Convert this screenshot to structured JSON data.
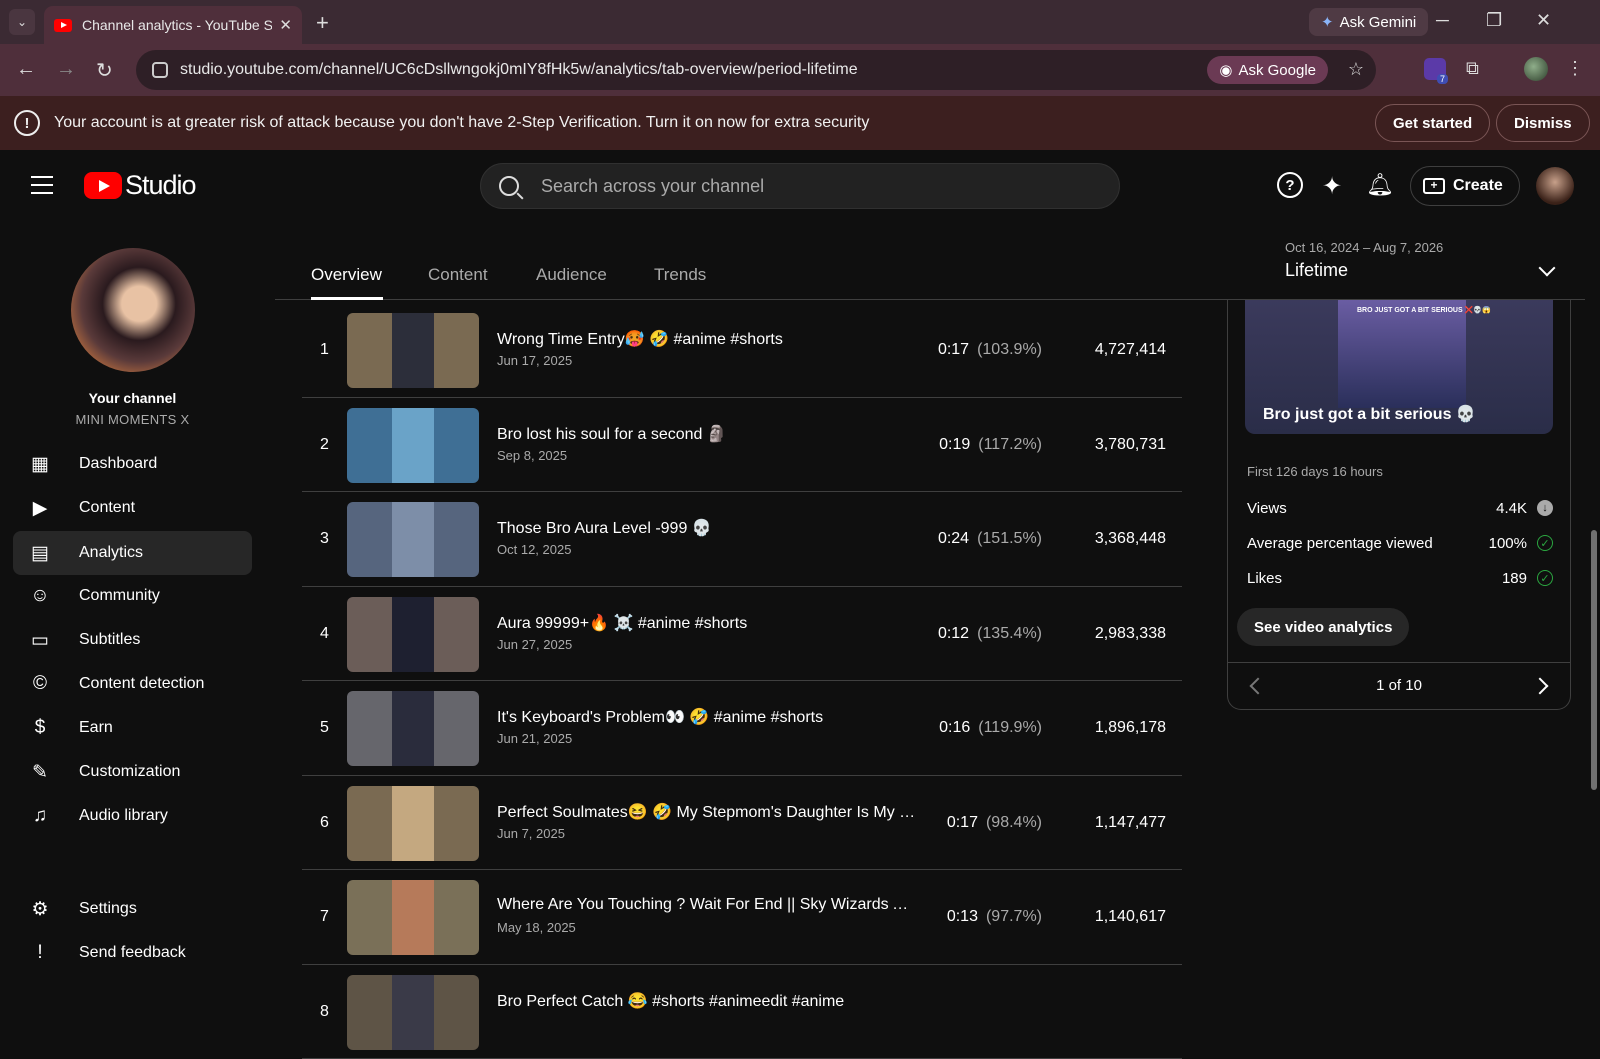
{
  "browser": {
    "tab_title": "Channel analytics - YouTube Studio",
    "new_tab": "+",
    "ask_gemini": "Ask Gemini",
    "url": "studio.youtube.com/channel/UC6cDsllwngokj0mIY8fHk5w/analytics/tab-overview/period-lifetime",
    "ask_google": "Ask Google",
    "ext_badge": "7"
  },
  "warning": {
    "text": "Your account is at greater risk of attack because you don't have 2-Step Verification. Turn it on now for extra security",
    "get_started": "Get started",
    "dismiss": "Dismiss"
  },
  "header": {
    "logo_text": "Studio",
    "search_placeholder": "Search across your channel",
    "create_label": "Create"
  },
  "sidebar": {
    "your_channel": "Your channel",
    "channel_name": "MINI MOMENTS X",
    "items": [
      {
        "label": "Dashboard"
      },
      {
        "label": "Content"
      },
      {
        "label": "Analytics"
      },
      {
        "label": "Community"
      },
      {
        "label": "Subtitles"
      },
      {
        "label": "Content detection"
      },
      {
        "label": "Earn"
      },
      {
        "label": "Customization"
      },
      {
        "label": "Audio library"
      },
      {
        "label": "Settings"
      },
      {
        "label": "Send feedback"
      }
    ]
  },
  "tabs": [
    "Overview",
    "Content",
    "Audience",
    "Trends"
  ],
  "period": {
    "range": "Oct 16, 2024 – Aug 7, 2026",
    "label": "Lifetime"
  },
  "videos": [
    {
      "rank": "1",
      "title": "Wrong Time Entry🥵 🤣 #anime #shorts",
      "date": "Jun 17, 2025",
      "avd": "0:17",
      "pct": "(103.9%)",
      "views": "4,727,414",
      "thumb_bg": "#7a6a52",
      "thumb_inner": "#2c2e3a"
    },
    {
      "rank": "2",
      "title": "Bro lost his soul for a second 🗿",
      "date": "Sep 8, 2025",
      "avd": "0:19",
      "pct": "(117.2%)",
      "views": "3,780,731",
      "thumb_bg": "#3f6f95",
      "thumb_inner": "#6aa3c8"
    },
    {
      "rank": "3",
      "title": "Those Bro Aura Level -999 💀",
      "date": "Oct 12, 2025",
      "avd": "0:24",
      "pct": "(151.5%)",
      "views": "3,368,448",
      "thumb_bg": "#56657e",
      "thumb_inner": "#7d8ea8"
    },
    {
      "rank": "4",
      "title": "Aura 99999+🔥 ☠️ #anime #shorts",
      "date": "Jun 27, 2025",
      "avd": "0:12",
      "pct": "(135.4%)",
      "views": "2,983,338",
      "thumb_bg": "#6b5d58",
      "thumb_inner": "#1e2030"
    },
    {
      "rank": "5",
      "title": "It's Keyboard's Problem👀 🤣 #anime #shorts",
      "date": "Jun 21, 2025",
      "avd": "0:16",
      "pct": "(119.9%)",
      "views": "1,896,178",
      "thumb_bg": "#66666c",
      "thumb_inner": "#2a2c3c"
    },
    {
      "rank": "6",
      "title": "Perfect Soulmates😆 🤣 My Stepmom's Daughter Is My Ex Girlfriend",
      "date": "Jun 7, 2025",
      "avd": "0:17",
      "pct": "(98.4%)",
      "views": "1,147,477",
      "thumb_bg": "#7a6a52",
      "thumb_inner": "#c4a880"
    },
    {
      "rank": "7",
      "title": "Where Are You Touching ? Wait For End || Sky Wizards Academy",
      "date": "May 18, 2025",
      "avd": "0:13",
      "pct": "(97.7%)",
      "views": "1,140,617",
      "thumb_bg": "#7a7058",
      "thumb_inner": "#b67a5a"
    },
    {
      "rank": "8",
      "title": "Bro Perfect Catch 😂 #shorts #animeedit #anime",
      "date": "",
      "avd": "",
      "pct": "",
      "views": "",
      "thumb_bg": "#5e5446",
      "thumb_inner": "#3a3a48"
    }
  ],
  "panel": {
    "thumb_caption": "BRO JUST GOT A BIT SERIOUS ❌💀😱",
    "video_title": "Bro just got a bit serious 💀",
    "subtitle": "First 126 days 16 hours",
    "metrics": [
      {
        "label": "Views",
        "value": "4.4K",
        "icon": "down-arrow-icon"
      },
      {
        "label": "Average percentage viewed",
        "value": "100%",
        "icon": "check-icon"
      },
      {
        "label": "Likes",
        "value": "189",
        "icon": "check-icon"
      }
    ],
    "see_analytics": "See video analytics",
    "pagination": "1 of 10"
  }
}
